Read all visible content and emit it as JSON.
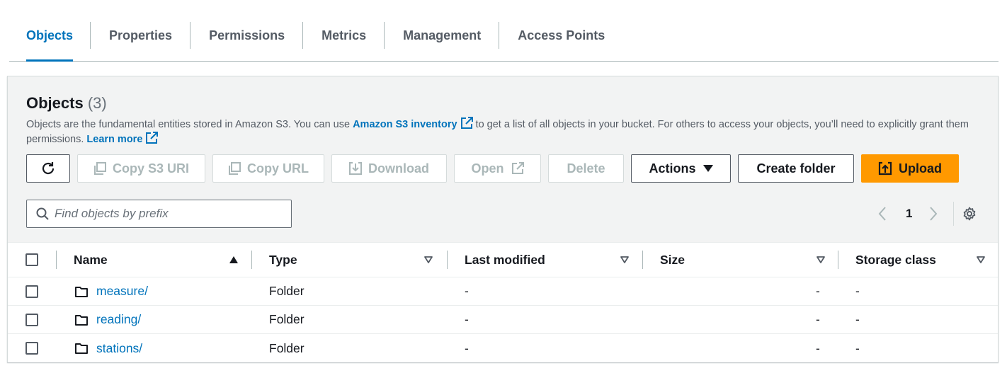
{
  "tabs": [
    {
      "label": "Objects",
      "active": true
    },
    {
      "label": "Properties"
    },
    {
      "label": "Permissions"
    },
    {
      "label": "Metrics"
    },
    {
      "label": "Management"
    },
    {
      "label": "Access Points"
    }
  ],
  "panel": {
    "title": "Objects",
    "count": "(3)",
    "desc_before": "Objects are the fundamental entities stored in Amazon S3. You can use ",
    "inventory_link": "Amazon S3 inventory",
    "desc_after": " to get a list of all objects in your bucket. For others to access your objects, you’ll need to explicitly grant them permissions. ",
    "learn_more": "Learn more"
  },
  "toolbar": {
    "refresh_icon": "refresh-icon",
    "copy_uri": "Copy S3 URI",
    "copy_url": "Copy URL",
    "download": "Download",
    "open": "Open",
    "delete": "Delete",
    "actions": "Actions",
    "create_folder": "Create folder",
    "upload": "Upload"
  },
  "search": {
    "placeholder": "Find objects by prefix",
    "value": ""
  },
  "pagination": {
    "page": "1"
  },
  "table": {
    "columns": [
      "Name",
      "Type",
      "Last modified",
      "Size",
      "Storage class"
    ],
    "rows": [
      {
        "name": "measure/",
        "type": "Folder",
        "modified": "-",
        "size": "-",
        "storage": "-"
      },
      {
        "name": "reading/",
        "type": "Folder",
        "modified": "-",
        "size": "-",
        "storage": "-"
      },
      {
        "name": "stations/",
        "type": "Folder",
        "modified": "-",
        "size": "-",
        "storage": "-"
      }
    ]
  },
  "colors": {
    "accent": "#0073bb",
    "primary_button": "#ff9900",
    "panel_bg": "#f2f3f3"
  }
}
